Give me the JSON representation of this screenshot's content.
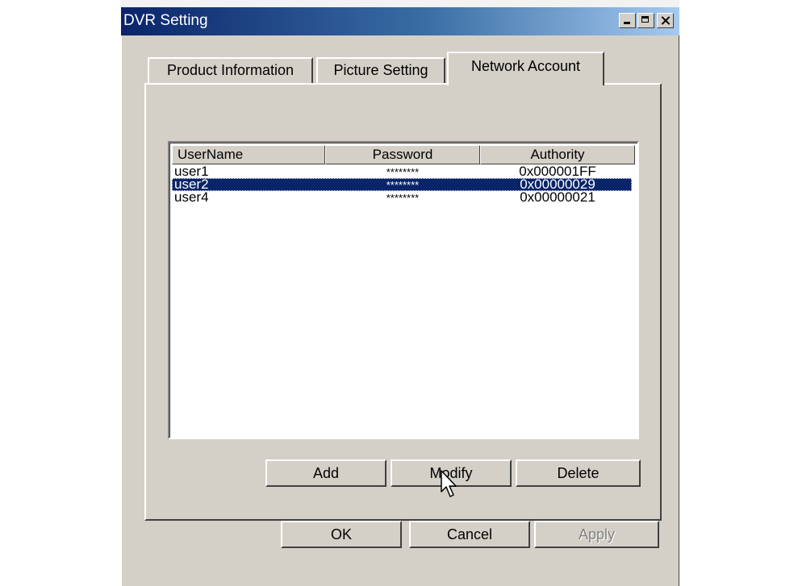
{
  "window": {
    "title": "DVR Setting"
  },
  "tabs": [
    {
      "label": "Product Information",
      "active": false
    },
    {
      "label": "Picture Setting",
      "active": false
    },
    {
      "label": "Network Account",
      "active": true
    }
  ],
  "account_list": {
    "columns": [
      "UserName",
      "Password",
      "Authority"
    ],
    "rows": [
      {
        "username": "user1",
        "password": "********",
        "authority": "0x000001FF",
        "selected": false
      },
      {
        "username": "user2",
        "password": "********",
        "authority": "0x00000029",
        "selected": true
      },
      {
        "username": "user4",
        "password": "********",
        "authority": "0x00000021",
        "selected": false
      }
    ]
  },
  "actions": {
    "add": "Add",
    "modify": "Modify",
    "delete": "Delete"
  },
  "footer": {
    "ok": "OK",
    "cancel": "Cancel",
    "apply": "Apply"
  },
  "colors": {
    "title_gradient_start": "#0a246a",
    "title_gradient_end": "#a6caf0",
    "selection": "#0a246a",
    "face": "#d4d0c8"
  }
}
